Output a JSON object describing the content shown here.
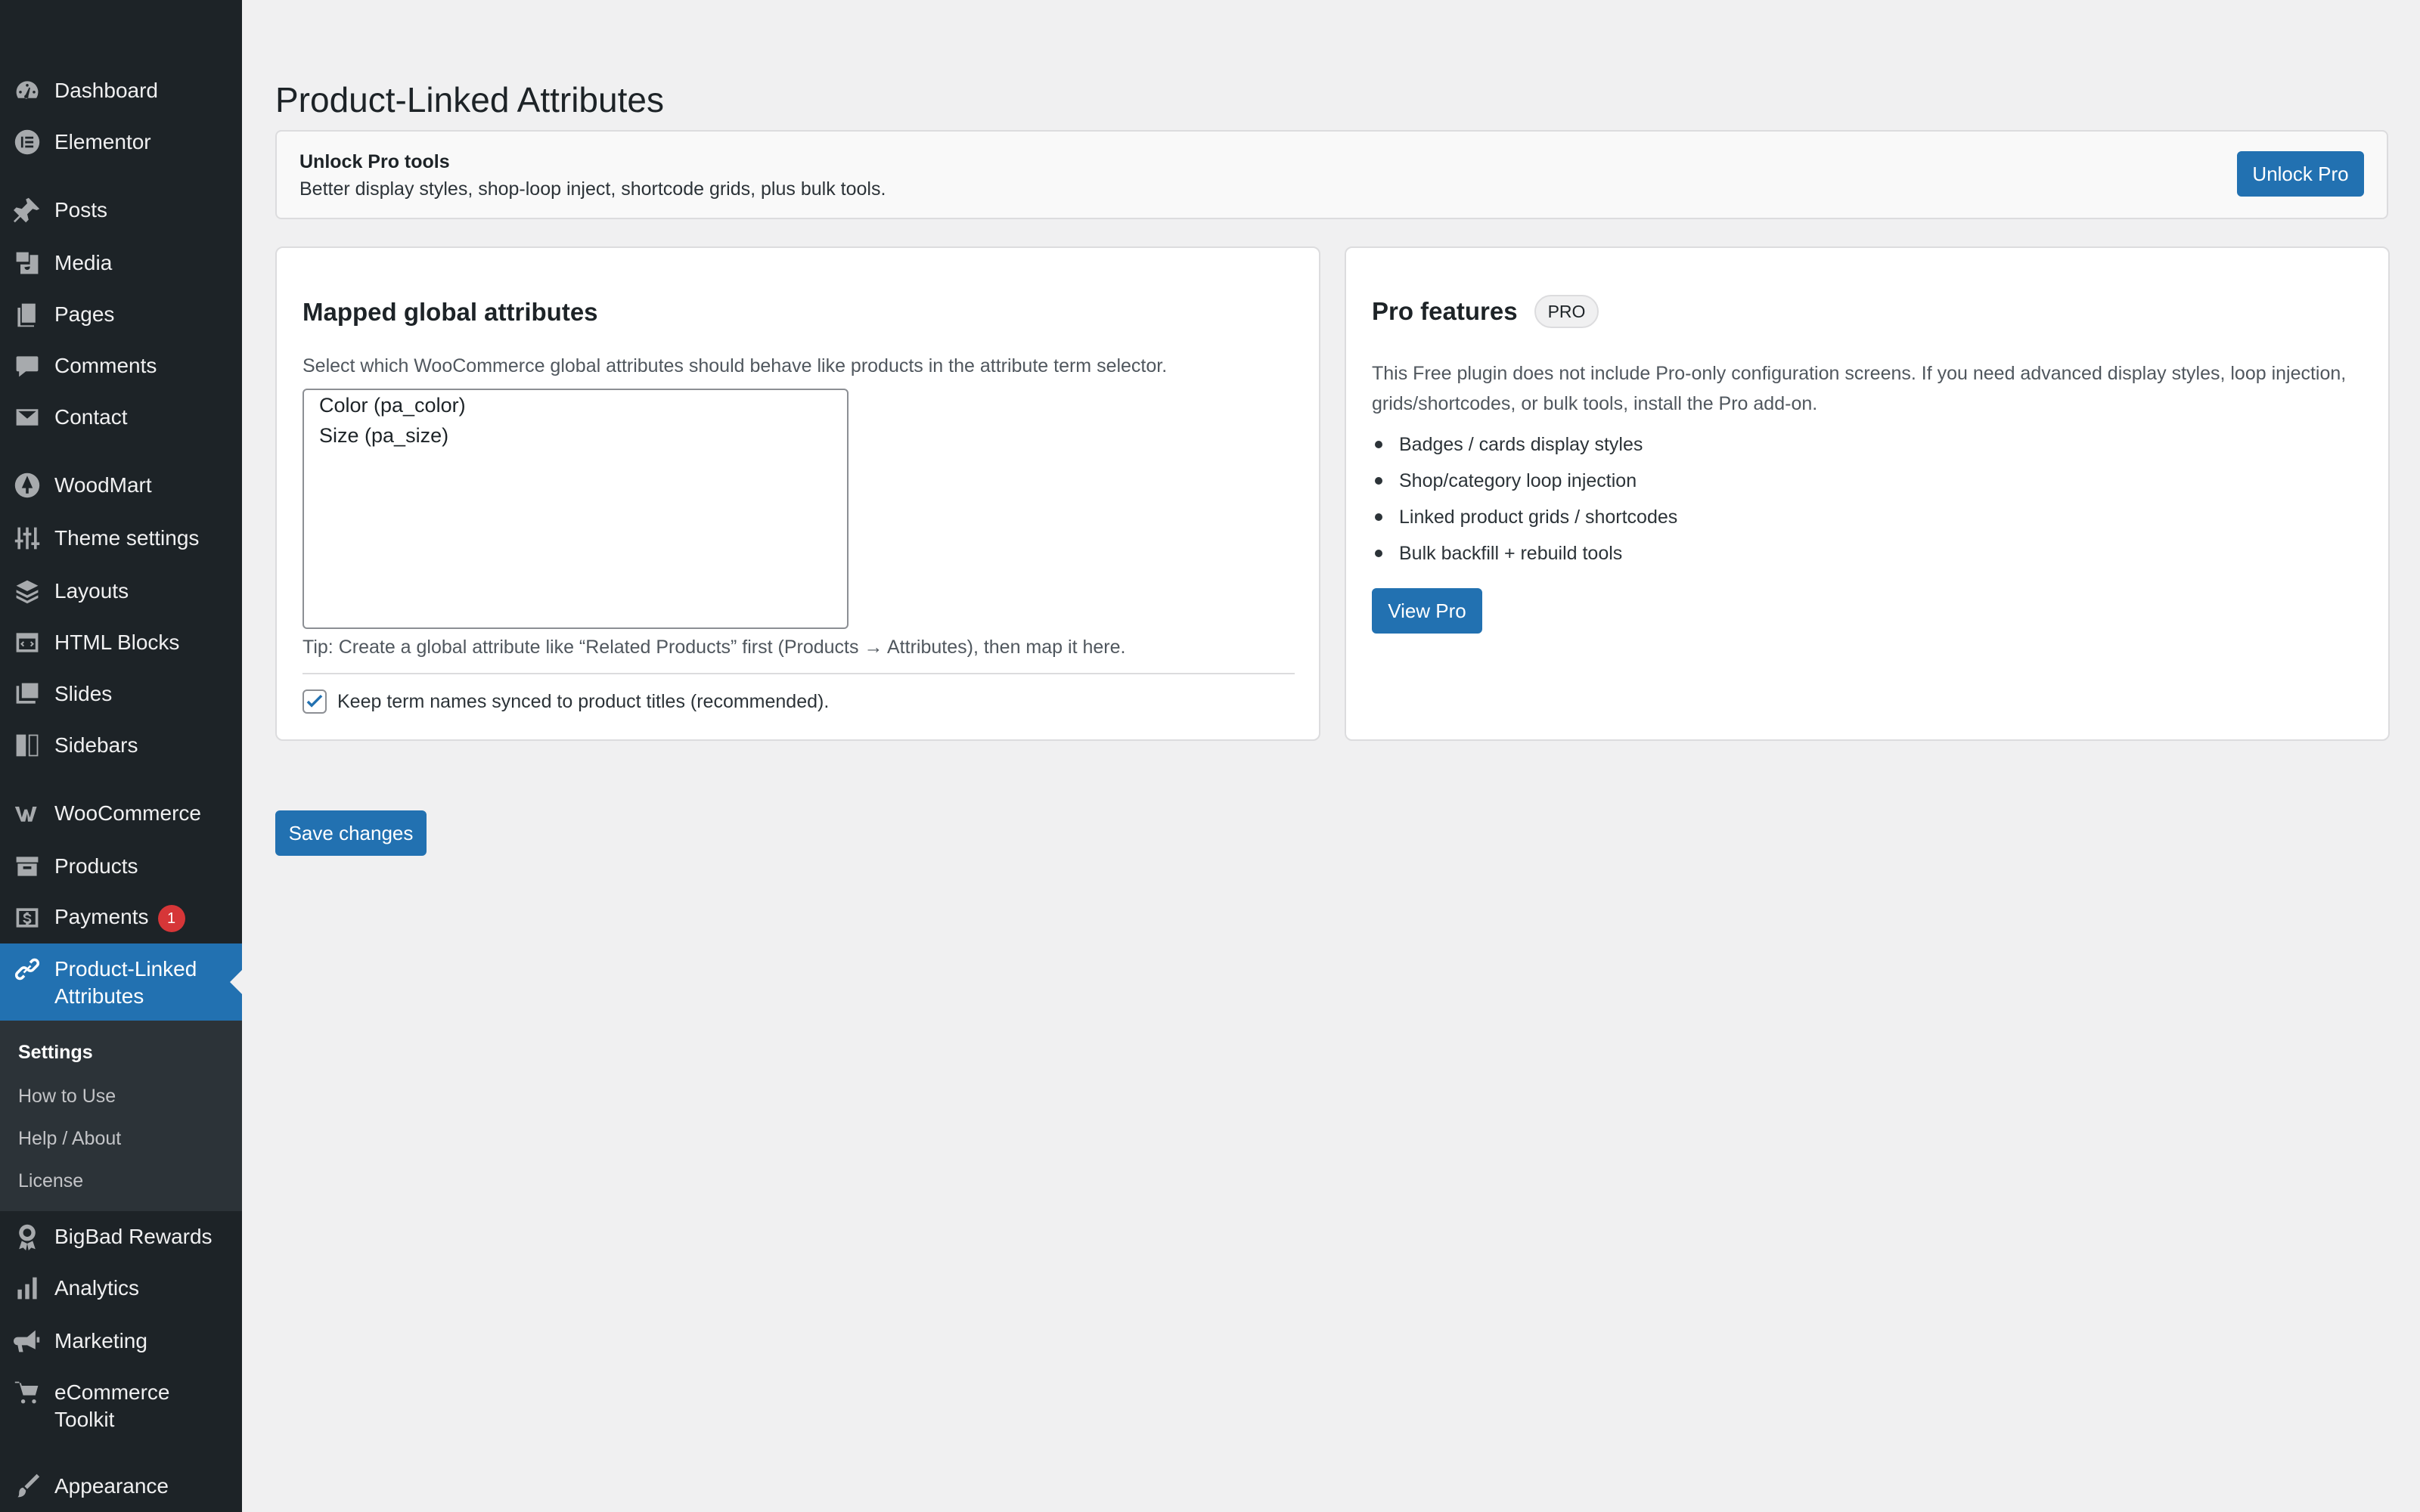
{
  "sidebar": {
    "items": [
      {
        "label": "Dashboard",
        "icon": "dashboard-icon"
      },
      {
        "label": "Elementor",
        "icon": "elementor-icon"
      },
      {
        "label": "Posts",
        "icon": "pin-icon"
      },
      {
        "label": "Media",
        "icon": "media-icon"
      },
      {
        "label": "Pages",
        "icon": "pages-icon"
      },
      {
        "label": "Comments",
        "icon": "comment-icon"
      },
      {
        "label": "Contact",
        "icon": "mail-icon"
      },
      {
        "label": "WoodMart",
        "icon": "woodmart-icon"
      },
      {
        "label": "Theme settings",
        "icon": "sliders-icon"
      },
      {
        "label": "Layouts",
        "icon": "layers-icon"
      },
      {
        "label": "HTML Blocks",
        "icon": "code-block-icon"
      },
      {
        "label": "Slides",
        "icon": "slides-icon"
      },
      {
        "label": "Sidebars",
        "icon": "sidebar-icon"
      },
      {
        "label": "WooCommerce",
        "icon": "woocommerce-icon"
      },
      {
        "label": "Products",
        "icon": "archive-icon"
      },
      {
        "label": "Payments",
        "icon": "dollar-icon",
        "badge": "1"
      },
      {
        "label": "Product-Linked",
        "label2": "Attributes",
        "icon": "link-icon"
      },
      {
        "label": "BigBad Rewards",
        "icon": "award-icon"
      },
      {
        "label": "Analytics",
        "icon": "bar-chart-icon"
      },
      {
        "label": "Marketing",
        "icon": "megaphone-icon"
      },
      {
        "label": "eCommerce",
        "label2": "Toolkit",
        "icon": "cart-icon"
      },
      {
        "label": "Appearance",
        "icon": "brush-icon"
      }
    ],
    "submenu": [
      "Settings",
      "How to Use",
      "Help / About",
      "License"
    ]
  },
  "page": {
    "title": "Product-Linked Attributes"
  },
  "notice": {
    "title": "Unlock Pro tools",
    "text": "Better display styles, shop-loop inject, shortcode grids, plus bulk tools.",
    "button": "Unlock Pro"
  },
  "mapped": {
    "title": "Mapped global attributes",
    "description": "Select which WooCommerce global attributes should behave like products in the attribute term selector.",
    "options": [
      "Color (pa_color)",
      "Size (pa_size)"
    ],
    "tip": "Tip: Create a global attribute like “Related Products” first (Products → Attributes), then map it here.",
    "checkbox_label": "Keep term names synced to product titles (recommended).",
    "checkbox_checked": true
  },
  "pro": {
    "title": "Pro features",
    "badge": "PRO",
    "description": "This Free plugin does not include Pro-only configuration screens. If you need advanced display styles, loop injection, grids/shortcodes, or bulk tools, install the Pro add-on.",
    "features": [
      "Badges / cards display styles",
      "Shop/category loop injection",
      "Linked product grids / shortcodes",
      "Bulk backfill + rebuild tools"
    ],
    "button": "View Pro"
  },
  "save_button": "Save changes",
  "colors": {
    "accent": "#2271b1",
    "sidebar": "#1d2327",
    "badge": "#d63638"
  }
}
